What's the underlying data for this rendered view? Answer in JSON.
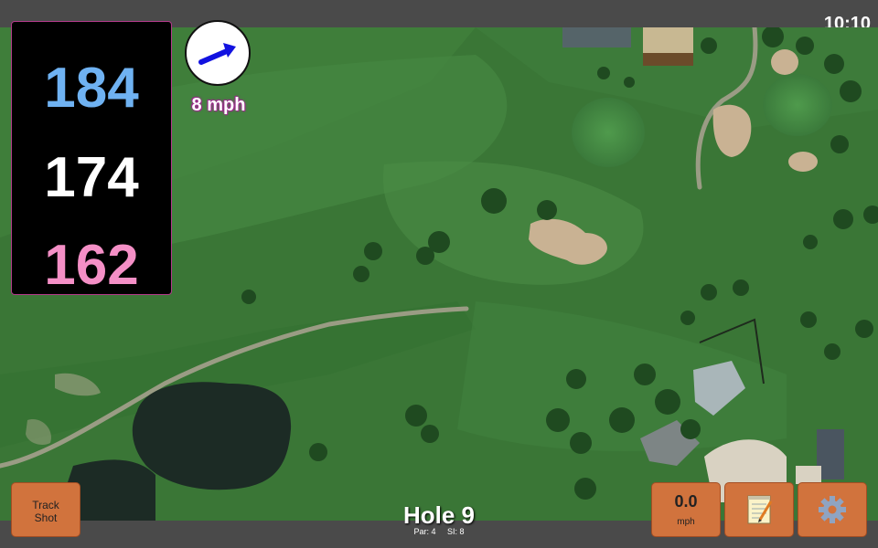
{
  "status_bar": {
    "time": "10:10"
  },
  "distances": {
    "back": "184",
    "middle": "174",
    "front": "162"
  },
  "wind": {
    "speed_label": "8 mph",
    "direction_icon": "arrow-up-right-icon"
  },
  "hole": {
    "title": "Hole 9",
    "par_label": "Par: 4",
    "si_label": "SI: 8"
  },
  "buttons": {
    "track_shot_line1": "Track",
    "track_shot_line2": "Shot",
    "speed_value": "0.0",
    "speed_unit": "mph",
    "notes_icon": "notepad-icon",
    "settings_icon": "gear-icon"
  },
  "colors": {
    "panel_bg": "#000000",
    "back_distance": "#6fb2f2",
    "middle_distance": "#ffffff",
    "front_distance": "#f48fc6",
    "button_orange": "#d1733d",
    "wind_text_glow": "#9d2a8e",
    "fairway_green": "#3d7b3a"
  }
}
